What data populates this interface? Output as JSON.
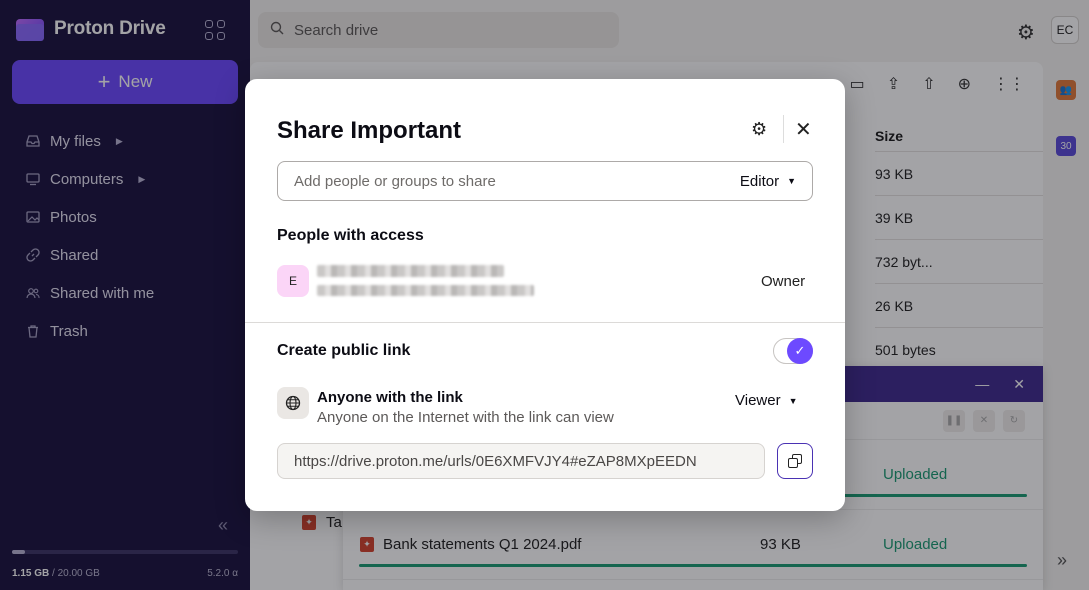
{
  "sidebar": {
    "brand": "Proton Drive",
    "new_label": "New",
    "items": [
      {
        "label": "My files",
        "icon": "inbox-icon",
        "has_caret": true
      },
      {
        "label": "Computers",
        "icon": "computer-icon",
        "has_caret": true
      },
      {
        "label": "Photos",
        "icon": "image-icon",
        "has_caret": false
      },
      {
        "label": "Shared",
        "icon": "link-icon",
        "has_caret": false
      },
      {
        "label": "Shared with me",
        "icon": "users-icon",
        "has_caret": false
      },
      {
        "label": "Trash",
        "icon": "trash-icon",
        "has_caret": false
      }
    ],
    "storage_used": "1.15 GB",
    "storage_total": "/ 20.00 GB",
    "storage_fraction": 0.0575,
    "version": "5.2.0 α"
  },
  "header": {
    "search_placeholder": "Search drive",
    "user_initials": "EC"
  },
  "file_list": {
    "size_header": "Size",
    "sizes": [
      "93 KB",
      "39 KB",
      "732 byt...",
      "26 KB",
      "501 bytes"
    ],
    "partial_row_text": "Ta"
  },
  "rail": {
    "calendar_badge": "30"
  },
  "transfers": {
    "rows": [
      {
        "name": "",
        "size": "",
        "status": "Uploaded"
      },
      {
        "name": "Bank statements Q1 2024.pdf",
        "size": "93 KB",
        "status": "Uploaded"
      }
    ]
  },
  "modal": {
    "title": "Share Important",
    "share_placeholder": "Add people or groups to share",
    "share_role": "Editor",
    "people_heading": "People with access",
    "owner_initial": "E",
    "owner_role": "Owner",
    "public_link_heading": "Create public link",
    "public_link_enabled": true,
    "link_audience_title": "Anyone with the link",
    "link_audience_desc": "Anyone on the Internet with the link can view",
    "link_role": "Viewer",
    "link_url": "https://drive.proton.me/urls/0E6XMFVJY4#eZAP8MXpEEDN"
  },
  "colors": {
    "accent": "#6d4aff",
    "sidebar_bg": "#1b1340",
    "success": "#1a9b73",
    "transfer_header": "#3f2b8f"
  }
}
